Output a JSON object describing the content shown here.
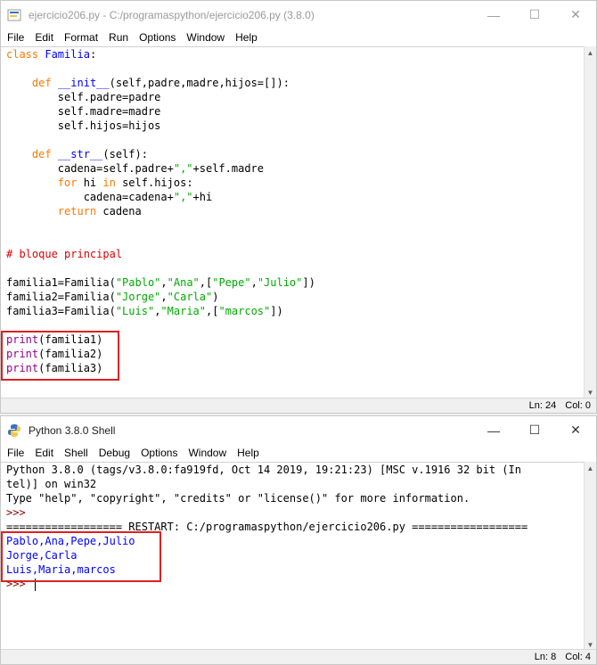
{
  "editor": {
    "title": "ejercicio206.py - C:/programaspython/ejercicio206.py (3.8.0)",
    "menu": [
      "File",
      "Edit",
      "Format",
      "Run",
      "Options",
      "Window",
      "Help"
    ],
    "code_lines": [
      [
        {
          "t": "class",
          "c": "kw"
        },
        {
          "t": " "
        },
        {
          "t": "Familia",
          "c": "df"
        },
        {
          "t": ":"
        }
      ],
      [
        {
          "t": ""
        }
      ],
      [
        {
          "t": "    "
        },
        {
          "t": "def",
          "c": "kw"
        },
        {
          "t": " "
        },
        {
          "t": "__init__",
          "c": "df"
        },
        {
          "t": "(self,padre,madre,hijos=[]):"
        }
      ],
      [
        {
          "t": "        self.padre=padre"
        }
      ],
      [
        {
          "t": "        self.madre=madre"
        }
      ],
      [
        {
          "t": "        self.hijos=hijos"
        }
      ],
      [
        {
          "t": ""
        }
      ],
      [
        {
          "t": "    "
        },
        {
          "t": "def",
          "c": "kw"
        },
        {
          "t": " "
        },
        {
          "t": "__str__",
          "c": "df"
        },
        {
          "t": "(self):"
        }
      ],
      [
        {
          "t": "        cadena=self.padre+"
        },
        {
          "t": "\",\"",
          "c": "st"
        },
        {
          "t": "+self.madre"
        }
      ],
      [
        {
          "t": "        "
        },
        {
          "t": "for",
          "c": "kw"
        },
        {
          "t": " hi "
        },
        {
          "t": "in",
          "c": "kw"
        },
        {
          "t": " self.hijos:"
        }
      ],
      [
        {
          "t": "            cadena=cadena+"
        },
        {
          "t": "\",\"",
          "c": "st"
        },
        {
          "t": "+hi"
        }
      ],
      [
        {
          "t": "        "
        },
        {
          "t": "return",
          "c": "kw"
        },
        {
          "t": " cadena"
        }
      ],
      [
        {
          "t": ""
        }
      ],
      [
        {
          "t": ""
        }
      ],
      [
        {
          "t": "# bloque principal",
          "c": "cm"
        }
      ],
      [
        {
          "t": ""
        }
      ],
      [
        {
          "t": "familia1=Familia("
        },
        {
          "t": "\"Pablo\"",
          "c": "st"
        },
        {
          "t": ","
        },
        {
          "t": "\"Ana\"",
          "c": "st"
        },
        {
          "t": ",["
        },
        {
          "t": "\"Pepe\"",
          "c": "st"
        },
        {
          "t": ","
        },
        {
          "t": "\"Julio\"",
          "c": "st"
        },
        {
          "t": "])"
        }
      ],
      [
        {
          "t": "familia2=Familia("
        },
        {
          "t": "\"Jorge\"",
          "c": "st"
        },
        {
          "t": ","
        },
        {
          "t": "\"Carla\"",
          "c": "st"
        },
        {
          "t": ")"
        }
      ],
      [
        {
          "t": "familia3=Familia("
        },
        {
          "t": "\"Luis\"",
          "c": "st"
        },
        {
          "t": ","
        },
        {
          "t": "\"Maria\"",
          "c": "st"
        },
        {
          "t": ",["
        },
        {
          "t": "\"marcos\"",
          "c": "st"
        },
        {
          "t": "])"
        }
      ],
      [
        {
          "t": ""
        }
      ],
      [
        {
          "t": "print",
          "c": "bi"
        },
        {
          "t": "(familia1)"
        }
      ],
      [
        {
          "t": "print",
          "c": "bi"
        },
        {
          "t": "(familia2)"
        }
      ],
      [
        {
          "t": "print",
          "c": "bi"
        },
        {
          "t": "(familia3)"
        }
      ]
    ],
    "status": {
      "line": "Ln: 24",
      "col": "Col: 0"
    }
  },
  "shell": {
    "title": "Python 3.8.0 Shell",
    "menu": [
      "File",
      "Edit",
      "Shell",
      "Debug",
      "Options",
      "Window",
      "Help"
    ],
    "lines": [
      [
        {
          "t": "Python 3.8.0 (tags/v3.8.0:fa919fd, Oct 14 2019, 19:21:23) [MSC v.1916 32 bit (In"
        }
      ],
      [
        {
          "t": "tel)] on win32"
        }
      ],
      [
        {
          "t": "Type \"help\", \"copyright\", \"credits\" or \"license()\" for more information."
        }
      ],
      [
        {
          "t": ">>> ",
          "c": "prompt"
        }
      ],
      [
        {
          "t": "================== RESTART: C:/programaspython/ejercicio206.py =================="
        }
      ],
      [
        {
          "t": "Pablo,Ana,Pepe,Julio",
          "c": "out"
        }
      ],
      [
        {
          "t": "Jorge,Carla",
          "c": "out"
        }
      ],
      [
        {
          "t": "Luis,Maria,marcos",
          "c": "out"
        }
      ],
      [
        {
          "t": ">>> ",
          "c": "prompt"
        },
        {
          "t": "",
          "cursor": true
        }
      ]
    ],
    "status": {
      "line": "Ln: 8",
      "col": "Col: 4"
    }
  },
  "window_controls": {
    "minimize": "—",
    "maximize": "☐",
    "close": "✕"
  }
}
